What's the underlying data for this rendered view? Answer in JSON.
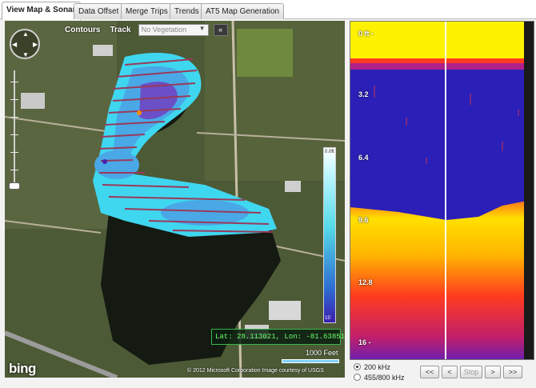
{
  "tabs": [
    {
      "label": "View Map & Sonar",
      "active": true
    },
    {
      "label": "Data Offset",
      "active": false
    },
    {
      "label": "Merge Trips",
      "active": false
    },
    {
      "label": "Trends",
      "active": false
    },
    {
      "label": "AT5 Map Generation",
      "active": false
    }
  ],
  "map": {
    "contours_label": "Contours",
    "track_label": "Track",
    "vegetation_select": {
      "value": "No Vegetation",
      "arrow_icon": "chevron-down-icon"
    },
    "collapse_label": "«",
    "legend": {
      "top_label": "0.0ft",
      "bottom_label": "15'"
    },
    "coordinates": "Lat: 28.113021, Lon: -81.638514",
    "scale_label": "1000 Feet",
    "provider_logo": "bing",
    "attribution": "© 2012 Microsoft Corporation   Image courtesy of USGS",
    "water_color": "#141a12",
    "survey_colors": {
      "shallow": "#3fd6f0",
      "mid": "#4aa8e6",
      "deep": "#6a4fc7",
      "track": "#9a3a5a"
    }
  },
  "sonar": {
    "depth_labels": [
      "0 ft -",
      "3.2",
      "6.4",
      "9.6",
      "12.8",
      "16 -"
    ],
    "colors": {
      "surface": "#fff200",
      "water": "#2b1fb8",
      "bottom": "#ffb400",
      "hard": "#ff3b1f"
    }
  },
  "frequency": {
    "options": [
      {
        "label": "200 kHz",
        "selected": true
      },
      {
        "label": "455/800 kHz",
        "selected": false
      }
    ]
  },
  "playback": {
    "rewind_label": "<<",
    "prev_label": "<",
    "stop_label": "Stop",
    "next_label": ">",
    "forward_label": ">>"
  }
}
